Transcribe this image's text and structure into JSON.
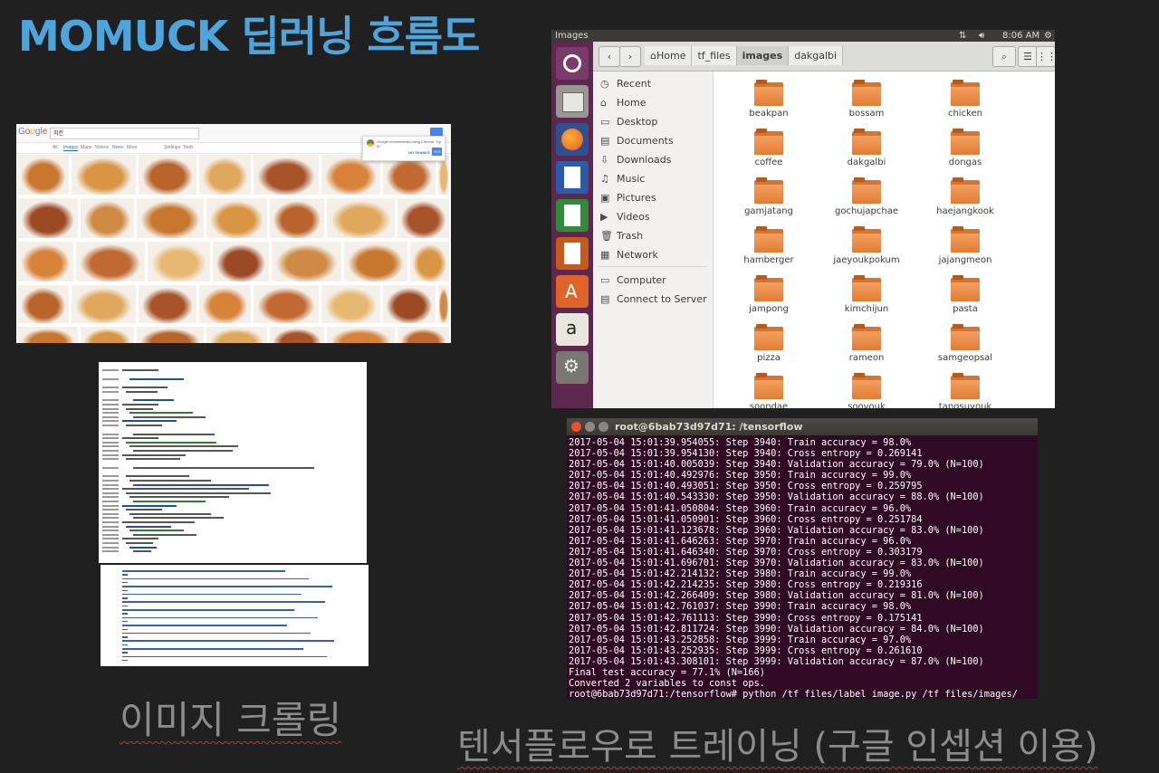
{
  "slide": {
    "title": "MOMUCK 딥러닝 흐름도",
    "caption_crawl": "이미지 크롤링",
    "caption_train": "텐서플로우로 트레이닝 (구글 인셉션 이용)"
  },
  "google": {
    "logo": "Google",
    "query": "치킨",
    "tabs": [
      "All",
      "Images",
      "Maps",
      "Videos",
      "News",
      "More",
      "Settings",
      "Tools"
    ],
    "popup_text": "Google recommends using Chrome. Try it?",
    "popup_no": "NO THANKS",
    "popup_yes": "YES"
  },
  "nautilus": {
    "panel_title": "Images",
    "clock": "8:06 AM",
    "breadcrumbs": [
      "Home",
      "tf_files",
      "images",
      "dakgalbi"
    ],
    "sidebar": [
      "Recent",
      "Home",
      "Desktop",
      "Documents",
      "Downloads",
      "Music",
      "Pictures",
      "Videos",
      "Trash",
      "Network",
      "Computer",
      "Connect to Server"
    ],
    "folders": [
      "beakpan",
      "bossam",
      "chicken",
      "coffee",
      "dakgalbi",
      "dongas",
      "gamjatang",
      "gochujapchae",
      "haejangkook",
      "hamberger",
      "jaeyoukpokum",
      "jajangmeon",
      "jampong",
      "kimchijun",
      "pasta",
      "pizza",
      "rameon",
      "samgeopsal",
      "soondae",
      "soovouk",
      "tangsuvouk"
    ]
  },
  "terminal": {
    "title": "root@6bab73d97d71: /tensorflow",
    "lines": [
      "2017-05-04 15:01:39.954055: Step 3940: Train accuracy = 98.0%",
      "2017-05-04 15:01:39.954130: Step 3940: Cross entropy = 0.269141",
      "2017-05-04 15:01:40.005039: Step 3940: Validation accuracy = 79.0% (N=100)",
      "2017-05-04 15:01:40.492976: Step 3950: Train accuracy = 99.0%",
      "2017-05-04 15:01:40.493051: Step 3950: Cross entropy = 0.259795",
      "2017-05-04 15:01:40.543330: Step 3950: Validation accuracy = 88.0% (N=100)",
      "2017-05-04 15:01:41.050804: Step 3960: Train accuracy = 96.0%",
      "2017-05-04 15:01:41.050901: Step 3960: Cross entropy = 0.251784",
      "2017-05-04 15:01:41.123678: Step 3960: Validation accuracy = 83.0% (N=100)",
      "2017-05-04 15:01:41.646263: Step 3970: Train accuracy = 96.0%",
      "2017-05-04 15:01:41.646340: Step 3970: Cross entropy = 0.303179",
      "2017-05-04 15:01:41.696701: Step 3970: Validation accuracy = 83.0% (N=100)",
      "2017-05-04 15:01:42.214132: Step 3980: Train accuracy = 99.0%",
      "2017-05-04 15:01:42.214235: Step 3980: Cross entropy = 0.219316",
      "2017-05-04 15:01:42.266409: Step 3980: Validation accuracy = 81.0% (N=100)",
      "2017-05-04 15:01:42.761037: Step 3990: Train accuracy = 98.0%",
      "2017-05-04 15:01:42.761113: Step 3990: Cross entropy = 0.175141",
      "2017-05-04 15:01:42.811724: Step 3990: Validation accuracy = 84.0% (N=100)",
      "2017-05-04 15:01:43.252858: Step 3999: Train accuracy = 97.0%",
      "2017-05-04 15:01:43.252935: Step 3999: Cross entropy = 0.261610",
      "2017-05-04 15:01:43.308101: Step 3999: Validation accuracy = 87.0% (N=100)",
      "Final test accuracy = 77.1% (N=166)",
      "Converted 2 variables to const ops.",
      "root@6bab73d97d71:/tensorflow# python /tf_files/label_image.py /tf_files/images/"
    ]
  },
  "colors": {
    "title_blue": "#4ea4dc",
    "caption_gray": "#8c8c8c",
    "terminal_bg": "#300a24",
    "launcher_bg": "#5e2750",
    "folder_orange": "#e27c34"
  }
}
